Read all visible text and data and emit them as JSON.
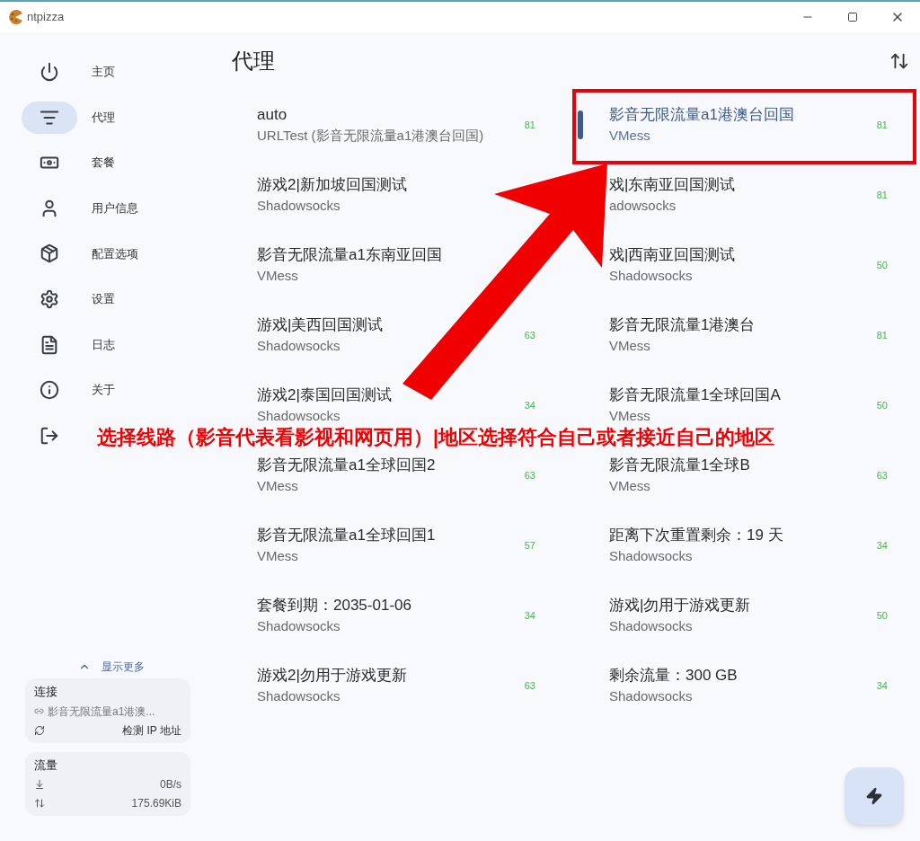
{
  "window": {
    "title": "ntpizza"
  },
  "sidebar": {
    "items": [
      {
        "label": "主页",
        "selected": false
      },
      {
        "label": "代理",
        "selected": true
      },
      {
        "label": "套餐",
        "selected": false
      },
      {
        "label": "用户信息",
        "selected": false
      },
      {
        "label": "配置选项",
        "selected": false
      },
      {
        "label": "设置",
        "selected": false
      },
      {
        "label": "日志",
        "selected": false
      },
      {
        "label": "关于",
        "selected": false
      },
      {
        "selected": false
      }
    ],
    "show_more": "显示更多",
    "connection": {
      "title": "连接",
      "proxy": "影音无限流量a1港澳...",
      "check_ip": "检测 IP 地址"
    },
    "traffic": {
      "title": "流量",
      "speed": "0B/s",
      "total": "175.69KiB"
    }
  },
  "page": {
    "title": "代理"
  },
  "proxies": [
    {
      "name": "auto",
      "type": "URLTest (影音无限流量a1港澳台回国)",
      "delay": "81",
      "selected": false
    },
    {
      "name": "影音无限流量a1港澳台回国",
      "type": "VMess",
      "delay": "81",
      "selected": true
    },
    {
      "name": "游戏2|新加坡回国测试",
      "type": "Shadowsocks",
      "selected": false
    },
    {
      "name": "戏|东南亚回国测试",
      "type": "adowsocks",
      "delay": "81",
      "selected": false
    },
    {
      "name": "影音无限流量a1东南亚回国",
      "type": "VMess",
      "selected": false
    },
    {
      "name": "戏|西南亚回国测试",
      "type": "Shadowsocks",
      "delay": "50",
      "selected": false
    },
    {
      "name": "游戏|美西回国测试",
      "type": "Shadowsocks",
      "delay": "63",
      "selected": false
    },
    {
      "name": "影音无限流量1港澳台",
      "type": "VMess",
      "delay": "81",
      "selected": false
    },
    {
      "name": "游戏2|泰国回国测试",
      "type": "Shadowsocks",
      "delay": "34",
      "selected": false
    },
    {
      "name": "影音无限流量1全球回国A",
      "type": "VMess",
      "delay": "50",
      "selected": false
    },
    {
      "name": "影音无限流量a1全球回国2",
      "type": "VMess",
      "delay": "63",
      "selected": false
    },
    {
      "name": "影音无限流量1全球B",
      "type": "VMess",
      "delay": "63",
      "selected": false
    },
    {
      "name": "影音无限流量a1全球回国1",
      "type": "VMess",
      "delay": "57",
      "selected": false
    },
    {
      "name": "距离下次重置剩余：19 天",
      "type": "Shadowsocks",
      "delay": "34",
      "selected": false
    },
    {
      "name": "套餐到期：2035-01-06",
      "type": "Shadowsocks",
      "delay": "34",
      "selected": false
    },
    {
      "name": "游戏|勿用于游戏更新",
      "type": "Shadowsocks",
      "delay": "50",
      "selected": false
    },
    {
      "name": "游戏2|勿用于游戏更新",
      "type": "Shadowsocks",
      "delay": "63",
      "selected": false
    },
    {
      "name": "剩余流量：300 GB",
      "type": "Shadowsocks",
      "delay": "34",
      "selected": false
    }
  ],
  "annotation": {
    "text": "选择线路（影音代表看影视和网页用）|地区选择符合自己或者接近自己的地区"
  }
}
